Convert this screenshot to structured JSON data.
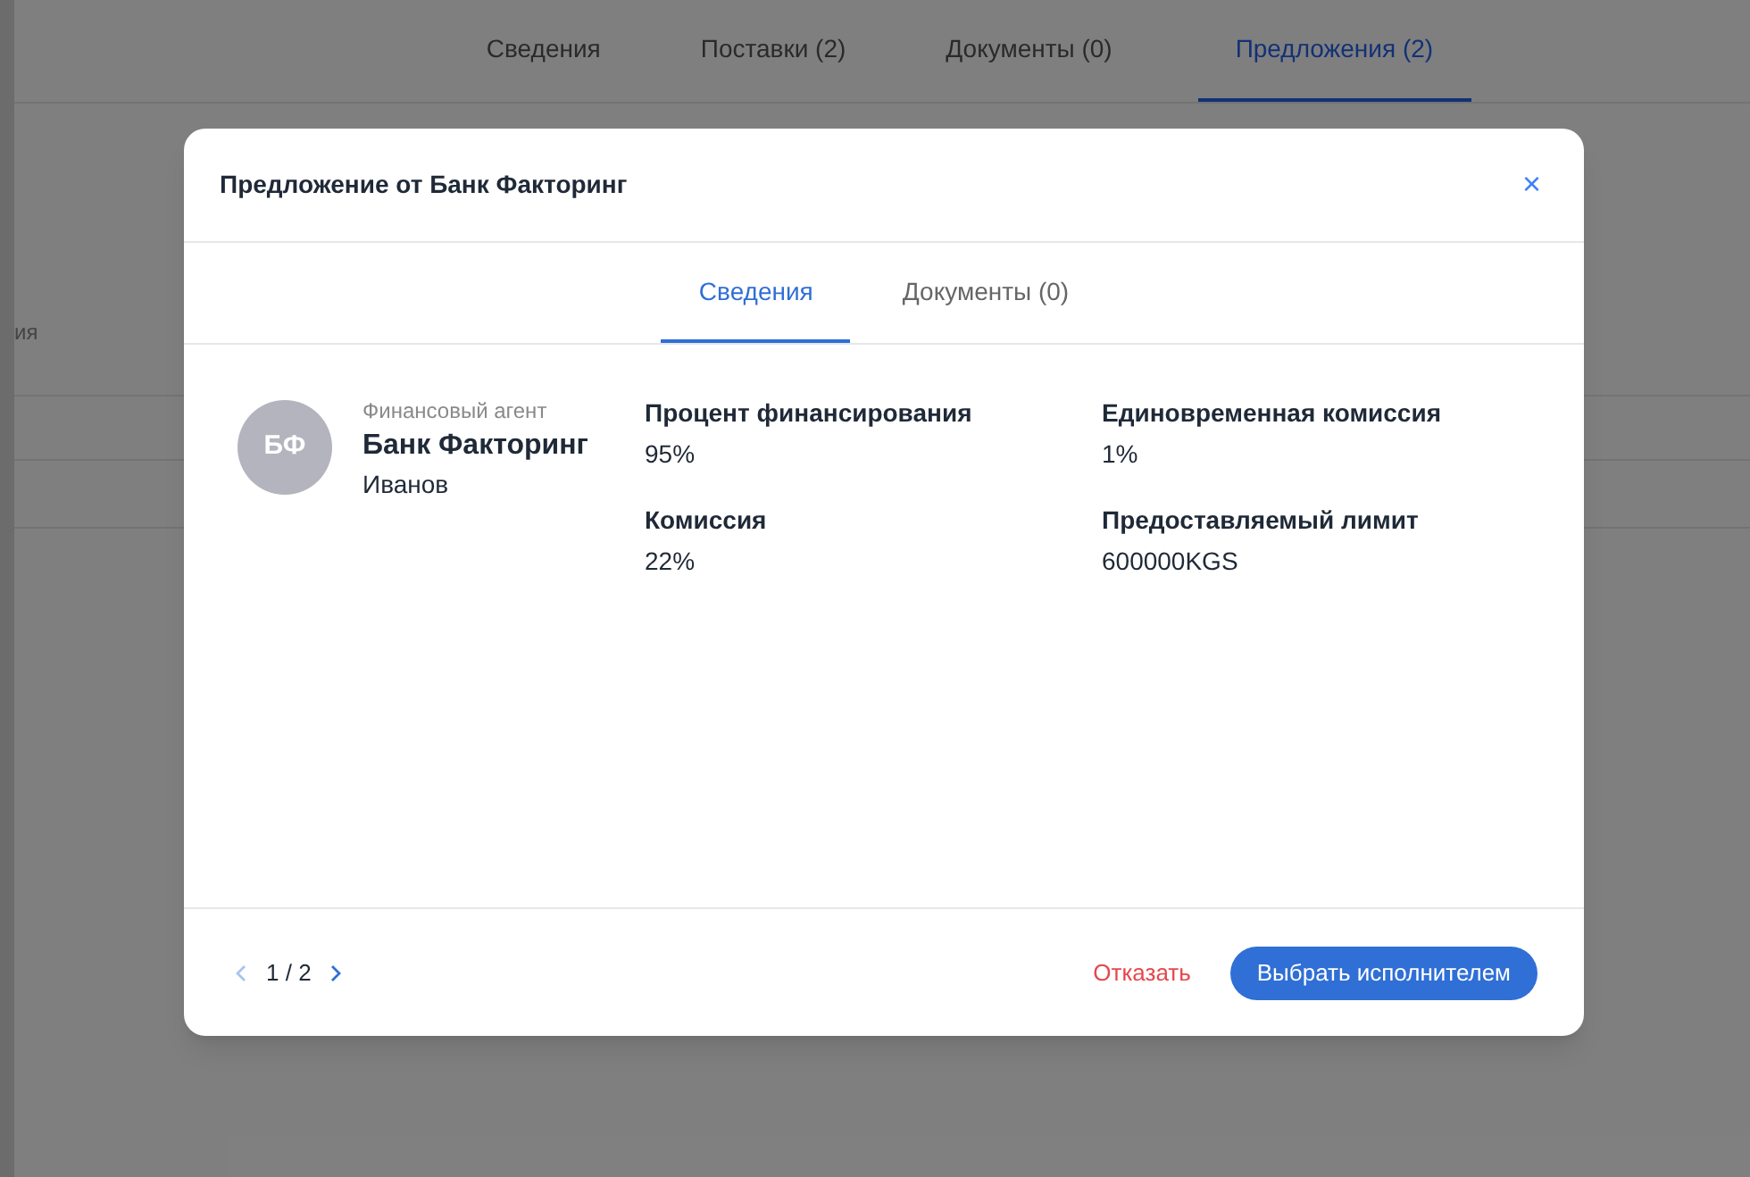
{
  "page": {
    "tabs": [
      {
        "label": "Сведения",
        "selected": false
      },
      {
        "label": "Поставки (2)",
        "selected": false
      },
      {
        "label": "Документы (0)",
        "selected": false
      },
      {
        "label": "Предложения (2)",
        "selected": true
      }
    ],
    "side_text": "ия"
  },
  "dialog": {
    "title": "Предложение от Банк Факторинг",
    "close": "×",
    "tabs": [
      {
        "label": "Сведения",
        "selected": true
      },
      {
        "label": "Документы (0)",
        "selected": false
      }
    ],
    "agent": {
      "initials": "БФ",
      "role": "Финансовый агент",
      "name": "Банк Факторинг",
      "contact": "Иванов"
    },
    "fields": [
      {
        "label": "Процент финансирования",
        "value": "95%"
      },
      {
        "label": "Единовременная комиссия",
        "value": "1%"
      },
      {
        "label": "Комиссия",
        "value": "22%"
      },
      {
        "label": "Предоставляемый лимит",
        "value": "600000KGS"
      }
    ],
    "pager": {
      "text": "1 / 2",
      "prev_disabled": true,
      "next_disabled": false
    },
    "buttons": [
      {
        "label": "Отказать",
        "kind": "link"
      },
      {
        "label": "Выбрать исполнителем",
        "kind": "primary"
      }
    ]
  }
}
